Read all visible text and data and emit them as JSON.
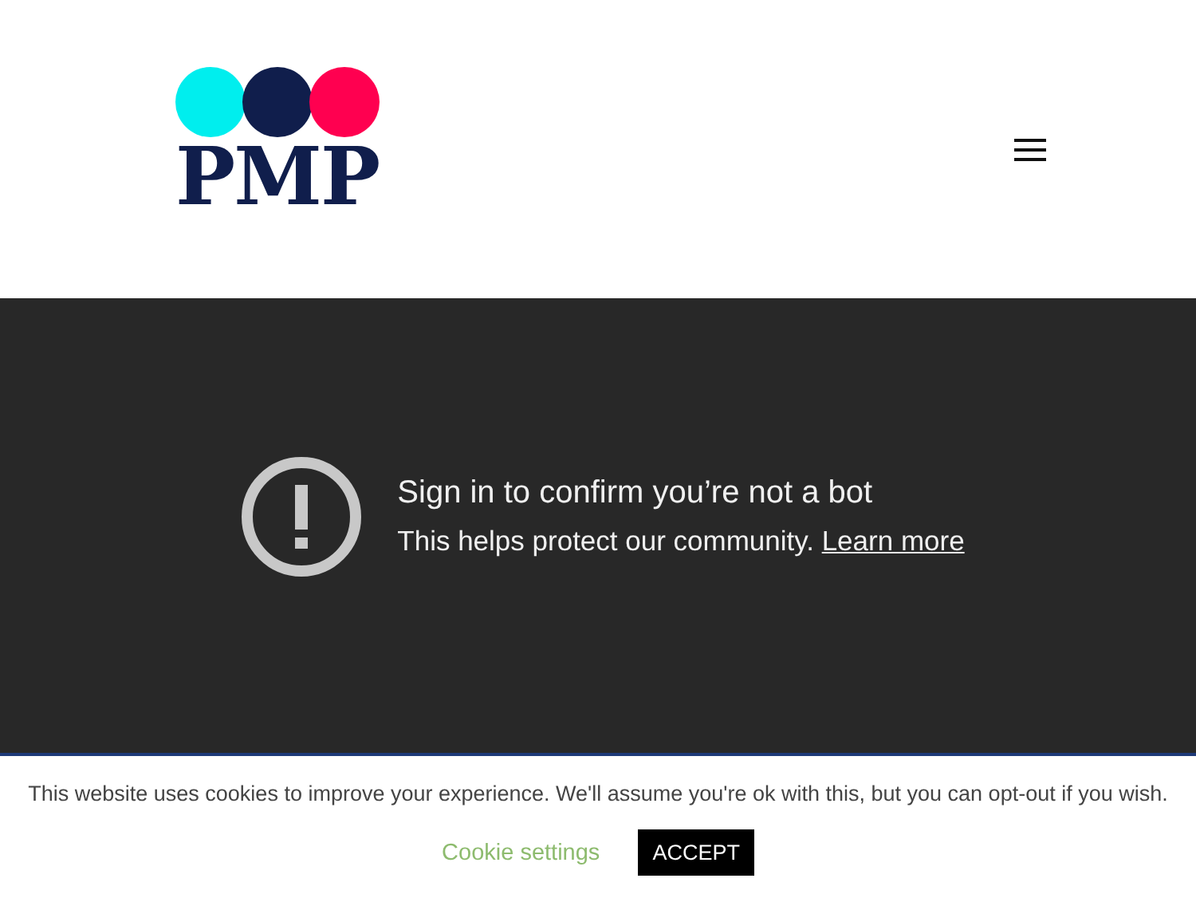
{
  "header": {
    "logo_text": "PMP"
  },
  "notice": {
    "title": "Sign in to confirm you’re not a bot",
    "text": "This helps protect our community.",
    "link": "Learn more"
  },
  "cookie_bar": {
    "text": "This website uses cookies to improve your experience. We'll assume you're ok with this, but you can opt-out if you wish.",
    "settings_link": "Cookie settings",
    "accept_button": "ACCEPT"
  }
}
